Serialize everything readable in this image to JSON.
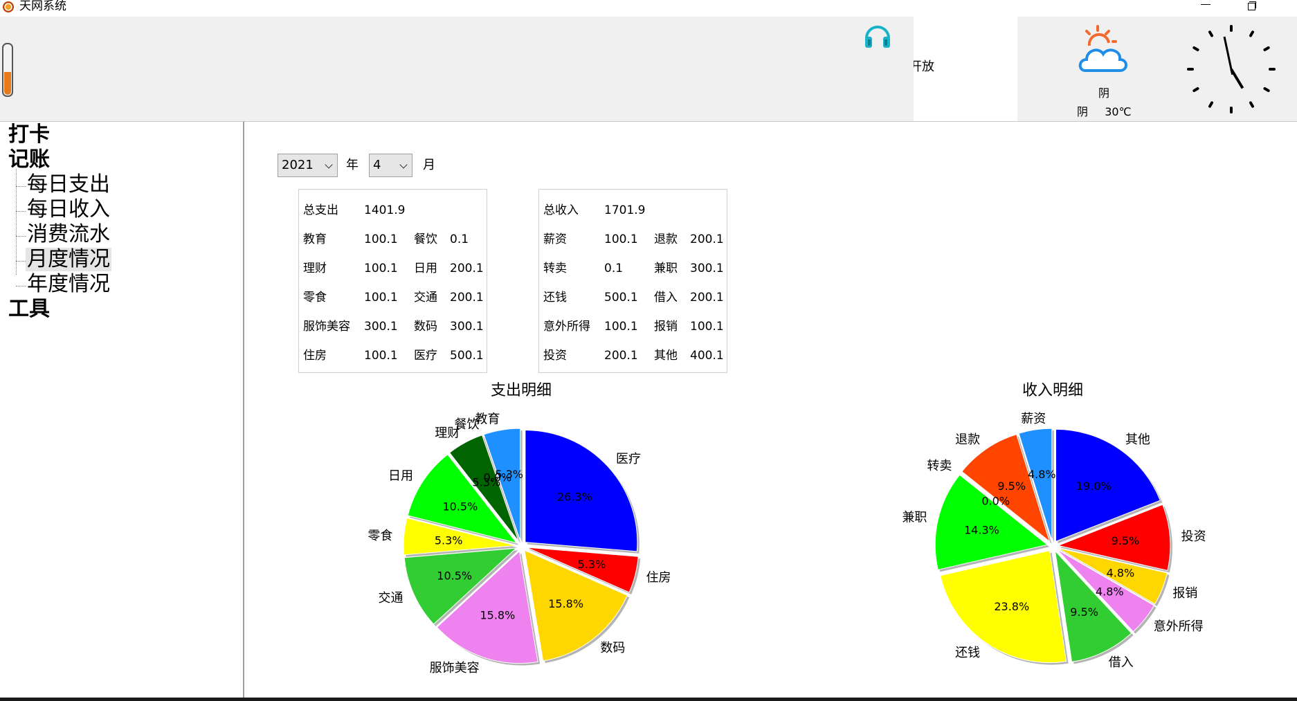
{
  "window": {
    "title": "天网系统"
  },
  "toolbar": {
    "volume_level": 0.45,
    "marquee_text": "开放"
  },
  "weather": {
    "desc": "阴",
    "condition": "阴",
    "temperature": "30℃"
  },
  "clock": {
    "hour": 4,
    "minute": 58
  },
  "tree": {
    "items": [
      {
        "label": "打卡",
        "level": 0
      },
      {
        "label": "记账",
        "level": 0
      },
      {
        "label": "每日支出",
        "level": 1
      },
      {
        "label": "每日收入",
        "level": 1
      },
      {
        "label": "消费流水",
        "level": 1
      },
      {
        "label": "月度情况",
        "level": 1,
        "selected": true
      },
      {
        "label": "年度情况",
        "level": 1
      },
      {
        "label": "工具",
        "level": 0
      }
    ]
  },
  "filters": {
    "year": "2021",
    "year_unit": "年",
    "month": "4",
    "month_unit": "月"
  },
  "expense_summary": {
    "total_label": "总支出",
    "total_value": "1401.9",
    "rows": [
      [
        "教育",
        "100.1",
        "餐饮",
        "0.1"
      ],
      [
        "理财",
        "100.1",
        "日用",
        "200.1"
      ],
      [
        "零食",
        "100.1",
        "交通",
        "200.1"
      ],
      [
        "服饰美容",
        "300.1",
        "数码",
        "300.1"
      ],
      [
        "住房",
        "100.1",
        "医疗",
        "500.1"
      ]
    ]
  },
  "income_summary": {
    "total_label": "总收入",
    "total_value": "1701.9",
    "rows": [
      [
        "薪资",
        "100.1",
        "退款",
        "200.1"
      ],
      [
        "转卖",
        "0.1",
        "兼职",
        "300.1"
      ],
      [
        "还钱",
        "500.1",
        "借入",
        "200.1"
      ],
      [
        "意外所得",
        "100.1",
        "报销",
        "100.1"
      ],
      [
        "投资",
        "200.1",
        "其他",
        "400.1"
      ]
    ]
  },
  "chart_data": [
    {
      "type": "pie",
      "title": "支出明细",
      "start_angle": 90,
      "direction": "counterclockwise",
      "slices": [
        {
          "label": "教育",
          "value": 100.1,
          "pct": "5.3%",
          "color": "#1e90ff"
        },
        {
          "label": "餐饮",
          "value": 0.1,
          "pct": "0.0%",
          "color": "#ff4500"
        },
        {
          "label": "理财",
          "value": 100.1,
          "pct": "5.3%",
          "color": "#006400"
        },
        {
          "label": "日用",
          "value": 200.1,
          "pct": "10.5%",
          "color": "#00ff00"
        },
        {
          "label": "零食",
          "value": 100.1,
          "pct": "5.3%",
          "color": "#ffff00"
        },
        {
          "label": "交通",
          "value": 200.1,
          "pct": "10.5%",
          "color": "#32cd32"
        },
        {
          "label": "服饰美容",
          "value": 300.1,
          "pct": "15.8%",
          "color": "#ee82ee"
        },
        {
          "label": "数码",
          "value": 300.1,
          "pct": "15.8%",
          "color": "#ffd700"
        },
        {
          "label": "住房",
          "value": 100.1,
          "pct": "5.3%",
          "color": "#ff0000"
        },
        {
          "label": "医疗",
          "value": 500.1,
          "pct": "26.3%",
          "color": "#0000ff"
        }
      ]
    },
    {
      "type": "pie",
      "title": "收入明细",
      "start_angle": 90,
      "direction": "counterclockwise",
      "slices": [
        {
          "label": "薪资",
          "value": 100.1,
          "pct": "4.8%",
          "color": "#1e90ff"
        },
        {
          "label": "退款",
          "value": 200.1,
          "pct": "9.5%",
          "color": "#ff4500"
        },
        {
          "label": "转卖",
          "value": 0.1,
          "pct": "0.0%",
          "color": "#006400"
        },
        {
          "label": "兼职",
          "value": 300.1,
          "pct": "14.3%",
          "color": "#00ff00"
        },
        {
          "label": "还钱",
          "value": 500.1,
          "pct": "23.8%",
          "color": "#ffff00"
        },
        {
          "label": "借入",
          "value": 200.1,
          "pct": "9.5%",
          "color": "#32cd32"
        },
        {
          "label": "意外所得",
          "value": 100.1,
          "pct": "4.8%",
          "color": "#ee82ee"
        },
        {
          "label": "报销",
          "value": 100.1,
          "pct": "4.8%",
          "color": "#ffd700"
        },
        {
          "label": "投资",
          "value": 200.1,
          "pct": "9.5%",
          "color": "#ff0000"
        },
        {
          "label": "其他",
          "value": 400.1,
          "pct": "19.0%",
          "color": "#0000ff"
        }
      ]
    }
  ]
}
